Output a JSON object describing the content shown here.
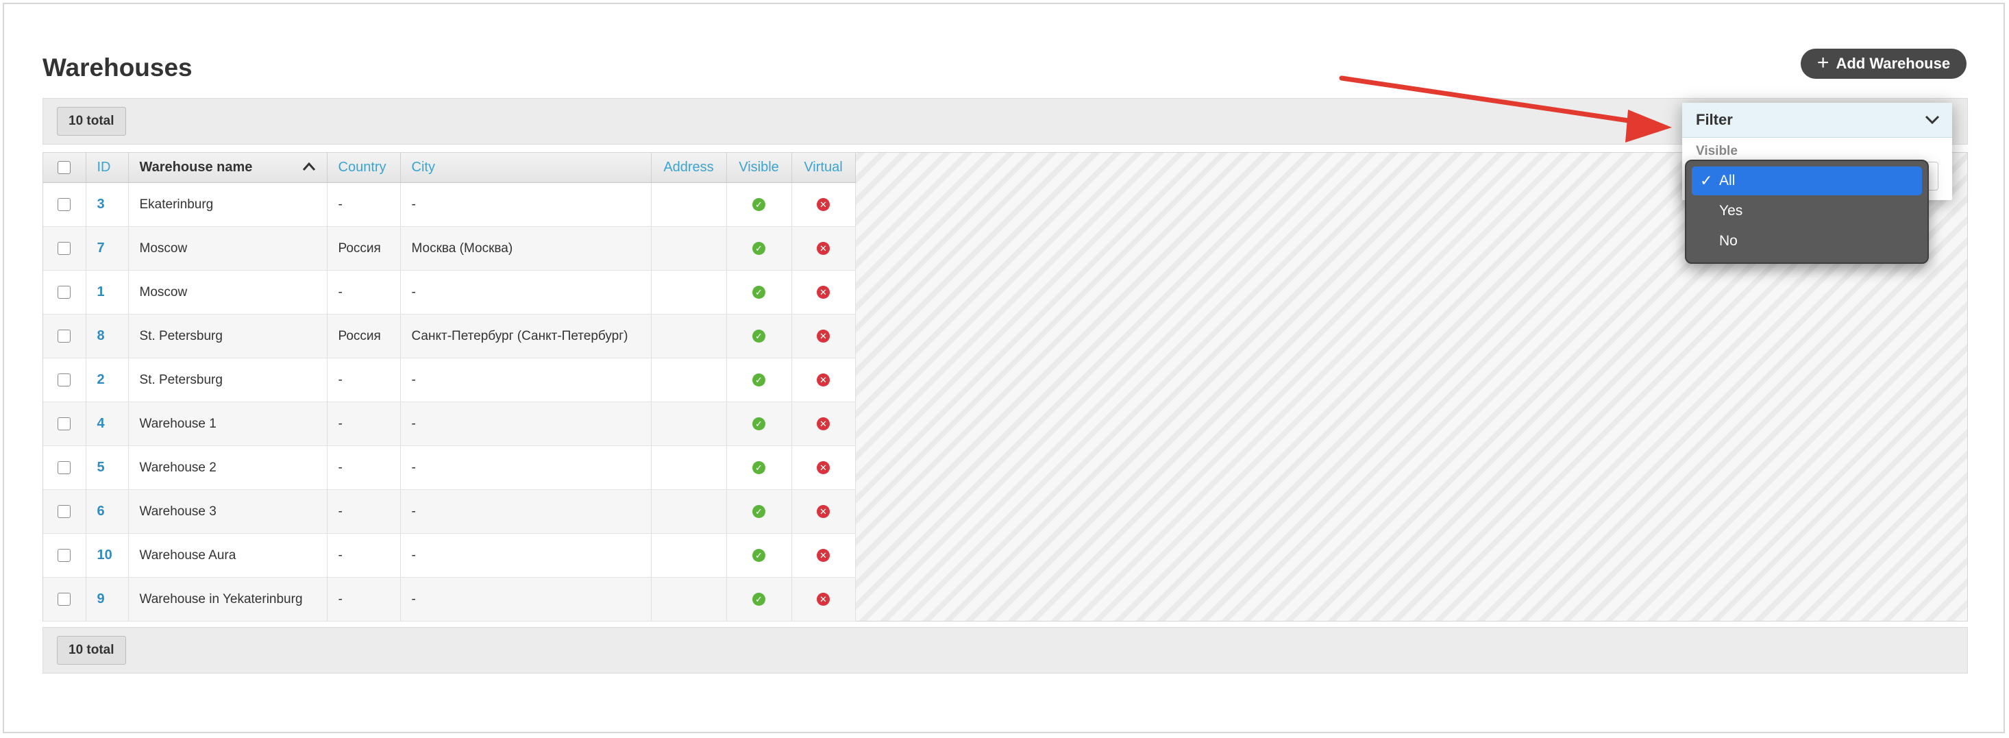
{
  "page": {
    "title": "Warehouses",
    "add_button_label": "Add Warehouse",
    "total_label": "10 total"
  },
  "table": {
    "columns": {
      "id": "ID",
      "name": "Warehouse name",
      "country": "Country",
      "city": "City",
      "address": "Address",
      "visible": "Visible",
      "virtual": "Virtual"
    },
    "sorted_column": "name",
    "rows": [
      {
        "id": "3",
        "name": "Ekaterinburg",
        "country": "-",
        "city": "-",
        "address": "",
        "visible": true,
        "virtual": false
      },
      {
        "id": "7",
        "name": "Moscow",
        "country": "Россия",
        "city": "Москва (Москва)",
        "address": "",
        "visible": true,
        "virtual": false
      },
      {
        "id": "1",
        "name": "Moscow",
        "country": "-",
        "city": "-",
        "address": "",
        "visible": true,
        "virtual": false
      },
      {
        "id": "8",
        "name": "St. Petersburg",
        "country": "Россия",
        "city": "Санкт-Петербург (Санкт-Петербург)",
        "address": "",
        "visible": true,
        "virtual": false
      },
      {
        "id": "2",
        "name": "St. Petersburg",
        "country": "-",
        "city": "-",
        "address": "",
        "visible": true,
        "virtual": false
      },
      {
        "id": "4",
        "name": "Warehouse 1",
        "country": "-",
        "city": "-",
        "address": "",
        "visible": true,
        "virtual": false
      },
      {
        "id": "5",
        "name": "Warehouse 2",
        "country": "-",
        "city": "-",
        "address": "",
        "visible": true,
        "virtual": false
      },
      {
        "id": "6",
        "name": "Warehouse 3",
        "country": "-",
        "city": "-",
        "address": "",
        "visible": true,
        "virtual": false
      },
      {
        "id": "10",
        "name": "Warehouse Aura",
        "country": "-",
        "city": "-",
        "address": "",
        "visible": true,
        "virtual": false
      },
      {
        "id": "9",
        "name": "Warehouse in Yekaterinburg",
        "country": "-",
        "city": "-",
        "address": "",
        "visible": true,
        "virtual": false
      }
    ]
  },
  "filter": {
    "title": "Filter",
    "field_label": "Visible",
    "options": [
      "All",
      "Yes",
      "No"
    ],
    "selected": "All"
  },
  "colors": {
    "link": "#2f8cc0",
    "header_link": "#3aa4cf",
    "visible_yes": "#5cb53a",
    "virtual_no": "#d9343d",
    "selected_option": "#2a78e6",
    "annotation_arrow": "#e23a2f",
    "button_bg": "#484848"
  },
  "icons": {
    "add": "plus-icon",
    "sort": "chevron-up-icon",
    "filter_toggle": "chevron-down-icon",
    "visible": "check-circle-icon",
    "virtual": "x-circle-icon",
    "selected_option": "checkmark-icon"
  }
}
